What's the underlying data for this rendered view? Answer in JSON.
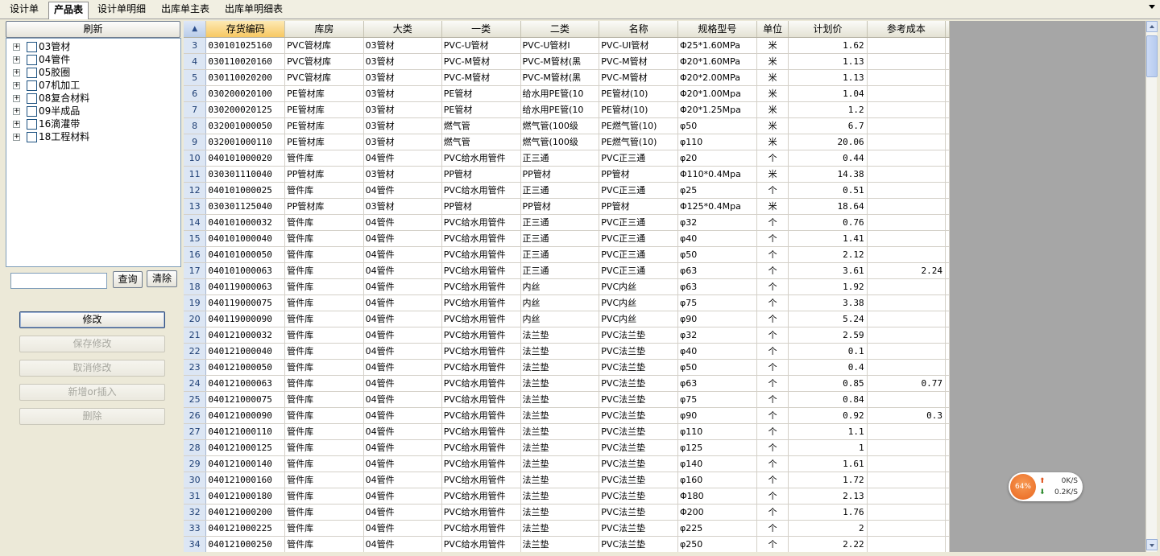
{
  "tabs": [
    {
      "label": "设计单",
      "active": false
    },
    {
      "label": "产品表",
      "active": true
    },
    {
      "label": "设计单明细",
      "active": false
    },
    {
      "label": "出库单主表",
      "active": false
    },
    {
      "label": "出库单明细表",
      "active": false
    }
  ],
  "left": {
    "refresh_label": "刷新",
    "tree": [
      "03管材",
      "04管件",
      "05胶圈",
      "07机加工",
      "08复合材料",
      "09半成品",
      "16滴灌带",
      "18工程材料"
    ],
    "search": {
      "value": "",
      "placeholder": ""
    },
    "query_label": "查询",
    "clear_label": "清除",
    "actions": [
      {
        "label": "修改",
        "enabled": true
      },
      {
        "label": "保存修改",
        "enabled": false
      },
      {
        "label": "取消修改",
        "enabled": false
      },
      {
        "label": "新增or插入",
        "enabled": false
      },
      {
        "label": "删除",
        "enabled": false
      }
    ]
  },
  "grid": {
    "corner_icon": "sort-up-icon",
    "columns": [
      "存货编码",
      "库房",
      "大类",
      "一类",
      "二类",
      "名称",
      "规格型号",
      "单位",
      "计划价",
      "参考成本"
    ],
    "rows": [
      {
        "n": "3",
        "code": "030101025160",
        "store": "PVC管材库",
        "cat": "03管材",
        "c1": "PVC-U管材",
        "c2": "PVC-U管材Ⅰ",
        "name": "PVC-UⅠ管材",
        "spec": "Φ25*1.60MPa",
        "unit": "米",
        "price": "1.62",
        "cost": ""
      },
      {
        "n": "4",
        "code": "030110020160",
        "store": "PVC管材库",
        "cat": "03管材",
        "c1": "PVC-M管材",
        "c2": "PVC-M管材(黑",
        "name": "PVC-M管材",
        "spec": "Φ20*1.60MPa",
        "unit": "米",
        "price": "1.13",
        "cost": ""
      },
      {
        "n": "5",
        "code": "030110020200",
        "store": "PVC管材库",
        "cat": "03管材",
        "c1": "PVC-M管材",
        "c2": "PVC-M管材(黑",
        "name": "PVC-M管材",
        "spec": "Φ20*2.00MPa",
        "unit": "米",
        "price": "1.13",
        "cost": ""
      },
      {
        "n": "6",
        "code": "030200020100",
        "store": "PE管材库",
        "cat": "03管材",
        "c1": "PE管材",
        "c2": "给水用PE管(10",
        "name": "PE管材(10)",
        "spec": "Φ20*1.00Mpa",
        "unit": "米",
        "price": "1.04",
        "cost": ""
      },
      {
        "n": "7",
        "code": "030200020125",
        "store": "PE管材库",
        "cat": "03管材",
        "c1": "PE管材",
        "c2": "给水用PE管(10",
        "name": "PE管材(10)",
        "spec": "Φ20*1.25Mpa",
        "unit": "米",
        "price": "1.2",
        "cost": ""
      },
      {
        "n": "8",
        "code": "032001000050",
        "store": "PE管材库",
        "cat": "03管材",
        "c1": "燃气管",
        "c2": "燃气管(100级",
        "name": "PE燃气管(10)",
        "spec": "φ50",
        "unit": "米",
        "price": "6.7",
        "cost": ""
      },
      {
        "n": "9",
        "code": "032001000110",
        "store": "PE管材库",
        "cat": "03管材",
        "c1": "燃气管",
        "c2": "燃气管(100级",
        "name": "PE燃气管(10)",
        "spec": "φ110",
        "unit": "米",
        "price": "20.06",
        "cost": ""
      },
      {
        "n": "10",
        "code": "040101000020",
        "store": "管件库",
        "cat": "04管件",
        "c1": "PVC给水用管件",
        "c2": "正三通",
        "name": "PVC正三通",
        "spec": "φ20",
        "unit": "个",
        "price": "0.44",
        "cost": ""
      },
      {
        "n": "11",
        "code": "030301110040",
        "store": "PP管材库",
        "cat": "03管材",
        "c1": "PP管材",
        "c2": "PP管材",
        "name": "PP管材",
        "spec": "Φ110*0.4Mpa",
        "unit": "米",
        "price": "14.38",
        "cost": ""
      },
      {
        "n": "12",
        "code": "040101000025",
        "store": "管件库",
        "cat": "04管件",
        "c1": "PVC给水用管件",
        "c2": "正三通",
        "name": "PVC正三通",
        "spec": "φ25",
        "unit": "个",
        "price": "0.51",
        "cost": ""
      },
      {
        "n": "13",
        "code": "030301125040",
        "store": "PP管材库",
        "cat": "03管材",
        "c1": "PP管材",
        "c2": "PP管材",
        "name": "PP管材",
        "spec": "Φ125*0.4Mpa",
        "unit": "米",
        "price": "18.64",
        "cost": ""
      },
      {
        "n": "14",
        "code": "040101000032",
        "store": "管件库",
        "cat": "04管件",
        "c1": "PVC给水用管件",
        "c2": "正三通",
        "name": "PVC正三通",
        "spec": "φ32",
        "unit": "个",
        "price": "0.76",
        "cost": ""
      },
      {
        "n": "15",
        "code": "040101000040",
        "store": "管件库",
        "cat": "04管件",
        "c1": "PVC给水用管件",
        "c2": "正三通",
        "name": "PVC正三通",
        "spec": "φ40",
        "unit": "个",
        "price": "1.41",
        "cost": ""
      },
      {
        "n": "16",
        "code": "040101000050",
        "store": "管件库",
        "cat": "04管件",
        "c1": "PVC给水用管件",
        "c2": "正三通",
        "name": "PVC正三通",
        "spec": "φ50",
        "unit": "个",
        "price": "2.12",
        "cost": ""
      },
      {
        "n": "17",
        "code": "040101000063",
        "store": "管件库",
        "cat": "04管件",
        "c1": "PVC给水用管件",
        "c2": "正三通",
        "name": "PVC正三通",
        "spec": "φ63",
        "unit": "个",
        "price": "3.61",
        "cost": "2.24"
      },
      {
        "n": "18",
        "code": "040119000063",
        "store": "管件库",
        "cat": "04管件",
        "c1": "PVC给水用管件",
        "c2": "内丝",
        "name": "PVC内丝",
        "spec": "φ63",
        "unit": "个",
        "price": "1.92",
        "cost": ""
      },
      {
        "n": "19",
        "code": "040119000075",
        "store": "管件库",
        "cat": "04管件",
        "c1": "PVC给水用管件",
        "c2": "内丝",
        "name": "PVC内丝",
        "spec": "φ75",
        "unit": "个",
        "price": "3.38",
        "cost": ""
      },
      {
        "n": "20",
        "code": "040119000090",
        "store": "管件库",
        "cat": "04管件",
        "c1": "PVC给水用管件",
        "c2": "内丝",
        "name": "PVC内丝",
        "spec": "φ90",
        "unit": "个",
        "price": "5.24",
        "cost": ""
      },
      {
        "n": "21",
        "code": "040121000032",
        "store": "管件库",
        "cat": "04管件",
        "c1": "PVC给水用管件",
        "c2": "法兰垫",
        "name": "PVC法兰垫",
        "spec": "φ32",
        "unit": "个",
        "price": "2.59",
        "cost": ""
      },
      {
        "n": "22",
        "code": "040121000040",
        "store": "管件库",
        "cat": "04管件",
        "c1": "PVC给水用管件",
        "c2": "法兰垫",
        "name": "PVC法兰垫",
        "spec": "φ40",
        "unit": "个",
        "price": "0.1",
        "cost": ""
      },
      {
        "n": "23",
        "code": "040121000050",
        "store": "管件库",
        "cat": "04管件",
        "c1": "PVC给水用管件",
        "c2": "法兰垫",
        "name": "PVC法兰垫",
        "spec": "φ50",
        "unit": "个",
        "price": "0.4",
        "cost": ""
      },
      {
        "n": "24",
        "code": "040121000063",
        "store": "管件库",
        "cat": "04管件",
        "c1": "PVC给水用管件",
        "c2": "法兰垫",
        "name": "PVC法兰垫",
        "spec": "φ63",
        "unit": "个",
        "price": "0.85",
        "cost": "0.77"
      },
      {
        "n": "25",
        "code": "040121000075",
        "store": "管件库",
        "cat": "04管件",
        "c1": "PVC给水用管件",
        "c2": "法兰垫",
        "name": "PVC法兰垫",
        "spec": "φ75",
        "unit": "个",
        "price": "0.84",
        "cost": ""
      },
      {
        "n": "26",
        "code": "040121000090",
        "store": "管件库",
        "cat": "04管件",
        "c1": "PVC给水用管件",
        "c2": "法兰垫",
        "name": "PVC法兰垫",
        "spec": "φ90",
        "unit": "个",
        "price": "0.92",
        "cost": "0.3"
      },
      {
        "n": "27",
        "code": "040121000110",
        "store": "管件库",
        "cat": "04管件",
        "c1": "PVC给水用管件",
        "c2": "法兰垫",
        "name": "PVC法兰垫",
        "spec": "φ110",
        "unit": "个",
        "price": "1.1",
        "cost": ""
      },
      {
        "n": "28",
        "code": "040121000125",
        "store": "管件库",
        "cat": "04管件",
        "c1": "PVC给水用管件",
        "c2": "法兰垫",
        "name": "PVC法兰垫",
        "spec": "φ125",
        "unit": "个",
        "price": "1",
        "cost": ""
      },
      {
        "n": "29",
        "code": "040121000140",
        "store": "管件库",
        "cat": "04管件",
        "c1": "PVC给水用管件",
        "c2": "法兰垫",
        "name": "PVC法兰垫",
        "spec": "φ140",
        "unit": "个",
        "price": "1.61",
        "cost": ""
      },
      {
        "n": "30",
        "code": "040121000160",
        "store": "管件库",
        "cat": "04管件",
        "c1": "PVC给水用管件",
        "c2": "法兰垫",
        "name": "PVC法兰垫",
        "spec": "φ160",
        "unit": "个",
        "price": "1.72",
        "cost": ""
      },
      {
        "n": "31",
        "code": "040121000180",
        "store": "管件库",
        "cat": "04管件",
        "c1": "PVC给水用管件",
        "c2": "法兰垫",
        "name": "PVC法兰垫",
        "spec": "Φ180",
        "unit": "个",
        "price": "2.13",
        "cost": ""
      },
      {
        "n": "32",
        "code": "040121000200",
        "store": "管件库",
        "cat": "04管件",
        "c1": "PVC给水用管件",
        "c2": "法兰垫",
        "name": "PVC法兰垫",
        "spec": "Φ200",
        "unit": "个",
        "price": "1.76",
        "cost": ""
      },
      {
        "n": "33",
        "code": "040121000225",
        "store": "管件库",
        "cat": "04管件",
        "c1": "PVC给水用管件",
        "c2": "法兰垫",
        "name": "PVC法兰垫",
        "spec": "φ225",
        "unit": "个",
        "price": "2",
        "cost": ""
      },
      {
        "n": "34",
        "code": "040121000250",
        "store": "管件库",
        "cat": "04管件",
        "c1": "PVC给水用管件",
        "c2": "法兰垫",
        "name": "PVC法兰垫",
        "spec": "φ250",
        "unit": "个",
        "price": "2.22",
        "cost": ""
      }
    ]
  },
  "net_widget": {
    "percent": "64%",
    "up": "0K/S",
    "down": "0.2K/S",
    "up_icon": "arrow-up-icon",
    "down_icon": "arrow-down-icon"
  },
  "colors": {
    "sorted_header": "#f7c863",
    "row_header": "#dce6f4",
    "accent": "#e9661f"
  }
}
